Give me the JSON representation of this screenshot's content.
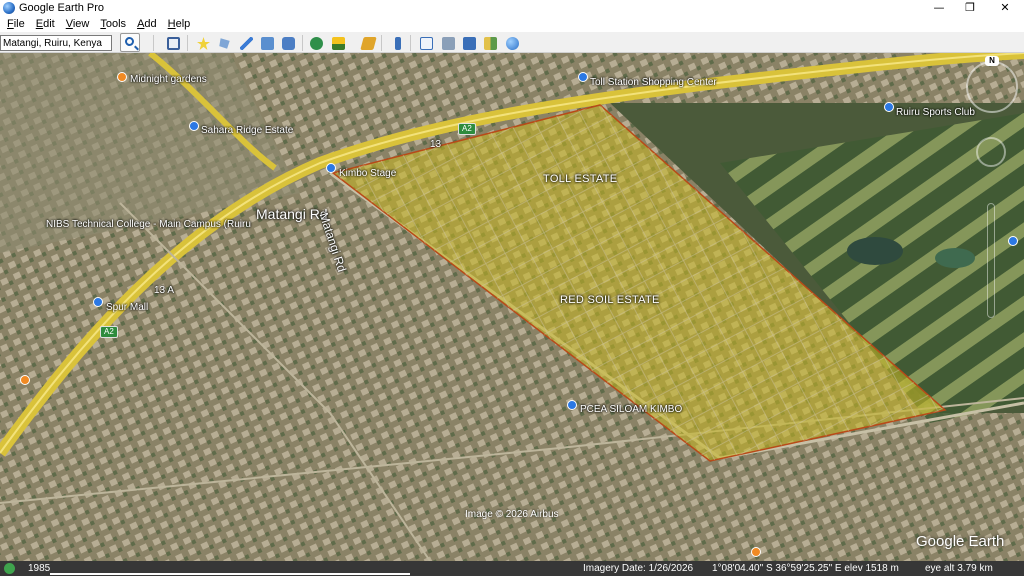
{
  "window": {
    "title": "Google Earth Pro",
    "minimize": "—",
    "maximize": "❐",
    "close": "✕"
  },
  "menu": {
    "file": "File",
    "edit": "Edit",
    "view": "View",
    "tools": "Tools",
    "add": "Add",
    "help": "Help"
  },
  "search": {
    "value": "Matangi, Ruiru, Kenya"
  },
  "toolbar_icons": [
    "sidebar-toggle-icon",
    "placemark-icon",
    "polygon-icon",
    "path-icon",
    "overlay-icon",
    "tour-icon",
    "historical-imagery-icon",
    "sunlight-icon",
    "planets-icon",
    "ruler-icon",
    "email-icon",
    "print-icon",
    "save-image-icon",
    "maps-icon",
    "earth-view-icon"
  ],
  "map": {
    "labels": {
      "midnight_gardens": "Midnight gardens",
      "sahara_ridge": "Sahara Ridge Estate",
      "nibs": "NIBS Technical College - Main Campus (Ruiru",
      "spur_mall": "Spur Mall",
      "kimbo_stage": "Kimbo Stage",
      "toll_station": "Toll Station Shopping Center",
      "ruiru_sports": "Ruiru Sports Club",
      "pcea": "PCEA SILOAM KIMBO",
      "matangi_rd_big": "Matangi Rd",
      "matangi_rd_small": "Matangi Rd",
      "road_13": "13",
      "road_13a": "13 A",
      "sign_a2_top": "A2",
      "sign_a2_left": "A2"
    },
    "estates": {
      "toll_estate": "TOLL ESTATE",
      "red_soil_estate": "RED SOIL ESTATE"
    },
    "image_credit": "Image © 2026 Airbus",
    "watermark": "Google Earth",
    "compass_north": "N",
    "polygon_fill": "#c8b820",
    "polygon_stroke": "#b84a18"
  },
  "status": {
    "year": "1985",
    "imagery_date": "Imagery Date: 1/26/2026",
    "coords": "1°08'04.40\" S   36°59'25.25\" E   elev  1518 m",
    "eye_alt": "eye alt    3.79 km"
  }
}
